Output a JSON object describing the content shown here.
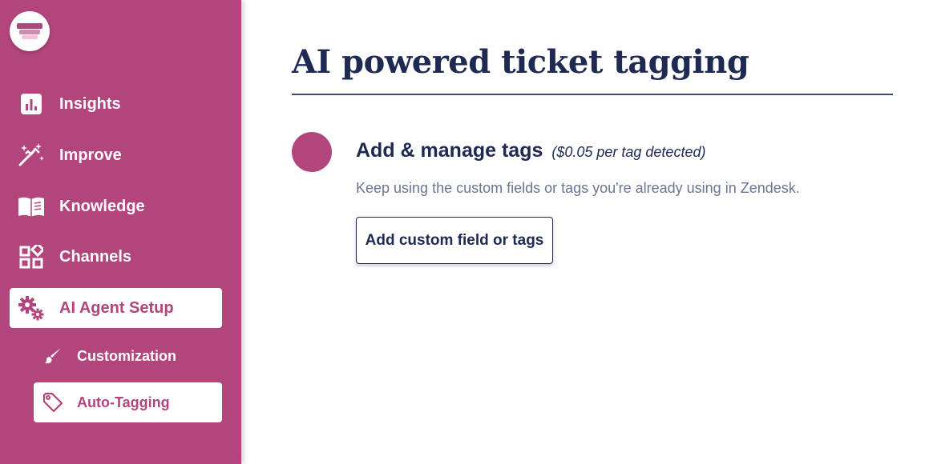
{
  "sidebar": {
    "logo_icon": "stacked-bars-logo",
    "items": [
      {
        "label": "Insights",
        "icon": "bar-chart-icon"
      },
      {
        "label": "Improve",
        "icon": "sparkle-wand-icon"
      },
      {
        "label": "Knowledge",
        "icon": "open-book-icon"
      },
      {
        "label": "Channels",
        "icon": "widgets-icon"
      },
      {
        "label": "AI Agent Setup",
        "icon": "gears-icon",
        "active": true
      }
    ],
    "sub_items": [
      {
        "label": "Customization",
        "icon": "brush-icon"
      },
      {
        "label": "Auto-Tagging",
        "icon": "tag-icon",
        "active": true
      }
    ]
  },
  "main": {
    "title": "AI powered ticket tagging",
    "section": {
      "heading": "Add & manage tags",
      "price": "($0.05 per tag detected)",
      "description": "Keep using the custom fields or tags you're already using in Zendesk.",
      "button_label": "Add custom field or tags"
    }
  },
  "colors": {
    "brand": "#b1457c",
    "navy": "#1f2a52",
    "muted_text": "#6b7591",
    "background": "#ffffff"
  }
}
